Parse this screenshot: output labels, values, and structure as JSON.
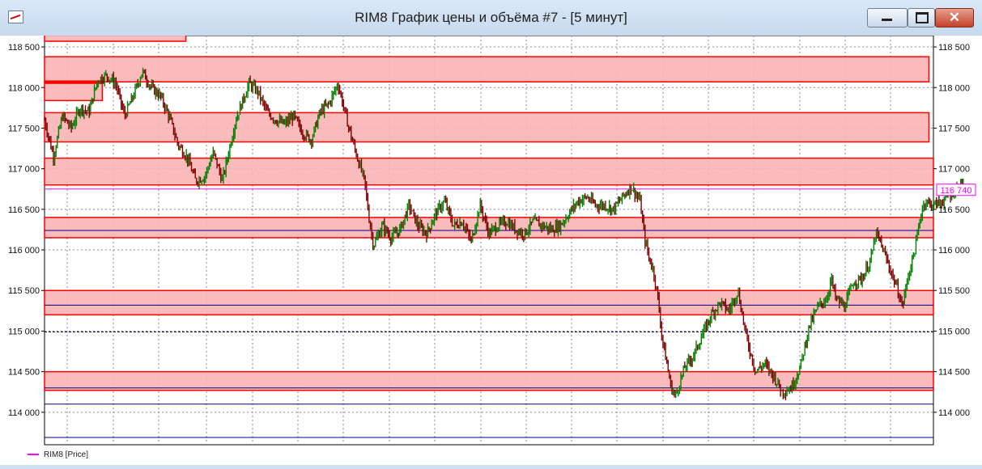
{
  "window": {
    "title": "RIM8 График цены и объёма #7 - [5 минут]",
    "minimize_icon": "minimize-icon",
    "maximize_icon": "maximize-icon",
    "close_icon": "close-icon"
  },
  "legend": {
    "label": "RIM8 [Price]",
    "color": "#ff00ff"
  },
  "chart_data": {
    "type": "candlestick",
    "y_tick_labels": [
      "118 500",
      "118 000",
      "117 500",
      "117 000",
      "116 500",
      "116 000",
      "115 500",
      "115 000",
      "114 500",
      "114 000"
    ],
    "y_ticks": [
      118500,
      118000,
      117500,
      117000,
      116500,
      116000,
      115500,
      115000,
      114500,
      114000
    ],
    "ylim": [
      113600,
      118640
    ],
    "last_price_label": "116 740",
    "last_price": 116740,
    "grid": true,
    "up_color": "#008000",
    "down_color": "#800000",
    "zone_fill": "#f8b4b4",
    "zone_border": "#ff0000",
    "level_color": "#000080",
    "zones": [
      {
        "x0": 0.0,
        "x1": 0.159,
        "y0": 118570,
        "y1": 118670
      },
      {
        "x0": 0.0,
        "x1": 0.995,
        "y0": 118070,
        "y1": 118380
      },
      {
        "x0": 0.0,
        "x1": 0.065,
        "y0": 117840,
        "y1": 118080
      },
      {
        "x0": 0.0,
        "x1": 0.995,
        "y0": 117330,
        "y1": 117690
      },
      {
        "x0": 0.0,
        "x1": 1.0,
        "y0": 116800,
        "y1": 117130
      },
      {
        "x0": 0.0,
        "x1": 1.0,
        "y0": 116150,
        "y1": 116400
      },
      {
        "x0": 0.0,
        "x1": 1.0,
        "y0": 115200,
        "y1": 115500
      },
      {
        "x0": 0.0,
        "x1": 1.0,
        "y0": 114270,
        "y1": 114500
      }
    ],
    "levels": [
      {
        "y": 118060,
        "color": "#ff0000",
        "width": 3,
        "x1": 0.065
      },
      {
        "y": 116750,
        "color": "#ff00ff",
        "width": 1,
        "x1": 1.0
      },
      {
        "y": 116240,
        "color": "#000080",
        "width": 1,
        "x1": 1.0
      },
      {
        "y": 115320,
        "color": "#000080",
        "width": 1,
        "x1": 1.0
      },
      {
        "y": 114990,
        "color": "#000080",
        "width": 1,
        "dash": true,
        "x1": 1.0
      },
      {
        "y": 114300,
        "color": "#000080",
        "width": 1,
        "x1": 1.0
      },
      {
        "y": 114100,
        "color": "#000080",
        "width": 1,
        "x1": 1.0
      },
      {
        "y": 113690,
        "color": "#000080",
        "width": 1,
        "x1": 1.0
      }
    ],
    "price_path": [
      [
        0,
        117600
      ],
      [
        0.01,
        117150
      ],
      [
        0.02,
        117650
      ],
      [
        0.03,
        117500
      ],
      [
        0.04,
        117750
      ],
      [
        0.05,
        117700
      ],
      [
        0.06,
        118100
      ],
      [
        0.07,
        118150
      ],
      [
        0.08,
        118050
      ],
      [
        0.09,
        117650
      ],
      [
        0.1,
        117900
      ],
      [
        0.11,
        118200
      ],
      [
        0.12,
        118000
      ],
      [
        0.13,
        117900
      ],
      [
        0.14,
        117650
      ],
      [
        0.15,
        117300
      ],
      [
        0.16,
        117150
      ],
      [
        0.17,
        116850
      ],
      [
        0.18,
        116900
      ],
      [
        0.19,
        117200
      ],
      [
        0.2,
        116850
      ],
      [
        0.21,
        117350
      ],
      [
        0.215,
        117600
      ],
      [
        0.22,
        117750
      ],
      [
        0.23,
        118050
      ],
      [
        0.24,
        117950
      ],
      [
        0.25,
        117700
      ],
      [
        0.26,
        117600
      ],
      [
        0.27,
        117550
      ],
      [
        0.28,
        117650
      ],
      [
        0.29,
        117450
      ],
      [
        0.3,
        117350
      ],
      [
        0.31,
        117700
      ],
      [
        0.32,
        117800
      ],
      [
        0.33,
        118050
      ],
      [
        0.34,
        117600
      ],
      [
        0.35,
        117200
      ],
      [
        0.36,
        116850
      ],
      [
        0.365,
        116400
      ],
      [
        0.37,
        116050
      ],
      [
        0.38,
        116300
      ],
      [
        0.39,
        116150
      ],
      [
        0.4,
        116250
      ],
      [
        0.41,
        116550
      ],
      [
        0.42,
        116300
      ],
      [
        0.43,
        116200
      ],
      [
        0.44,
        116450
      ],
      [
        0.45,
        116600
      ],
      [
        0.46,
        116300
      ],
      [
        0.47,
        116350
      ],
      [
        0.48,
        116100
      ],
      [
        0.49,
        116550
      ],
      [
        0.5,
        116200
      ],
      [
        0.51,
        116300
      ],
      [
        0.52,
        116350
      ],
      [
        0.53,
        116250
      ],
      [
        0.54,
        116200
      ],
      [
        0.55,
        116350
      ],
      [
        0.56,
        116300
      ],
      [
        0.57,
        116250
      ],
      [
        0.58,
        116300
      ],
      [
        0.59,
        116450
      ],
      [
        0.6,
        116600
      ],
      [
        0.61,
        116650
      ],
      [
        0.62,
        116550
      ],
      [
        0.63,
        116550
      ],
      [
        0.64,
        116500
      ],
      [
        0.65,
        116650
      ],
      [
        0.66,
        116780
      ],
      [
        0.67,
        116600
      ],
      [
        0.675,
        116150
      ],
      [
        0.68,
        115900
      ],
      [
        0.685,
        115750
      ],
      [
        0.69,
        115400
      ],
      [
        0.695,
        114900
      ],
      [
        0.7,
        114600
      ],
      [
        0.705,
        114300
      ],
      [
        0.71,
        114200
      ],
      [
        0.72,
        114550
      ],
      [
        0.73,
        114700
      ],
      [
        0.74,
        114950
      ],
      [
        0.75,
        115200
      ],
      [
        0.76,
        115350
      ],
      [
        0.77,
        115250
      ],
      [
        0.78,
        115500
      ],
      [
        0.785,
        115200
      ],
      [
        0.79,
        114900
      ],
      [
        0.8,
        114500
      ],
      [
        0.81,
        114600
      ],
      [
        0.82,
        114450
      ],
      [
        0.83,
        114250
      ],
      [
        0.84,
        114300
      ],
      [
        0.85,
        114550
      ],
      [
        0.86,
        115050
      ],
      [
        0.87,
        115300
      ],
      [
        0.88,
        115400
      ],
      [
        0.885,
        115650
      ],
      [
        0.89,
        115400
      ],
      [
        0.9,
        115300
      ],
      [
        0.91,
        115600
      ],
      [
        0.92,
        115650
      ],
      [
        0.93,
        115900
      ],
      [
        0.935,
        116200
      ],
      [
        0.94,
        116100
      ],
      [
        0.95,
        115800
      ],
      [
        0.96,
        115500
      ],
      [
        0.965,
        115300
      ],
      [
        0.97,
        115600
      ],
      [
        0.98,
        116050
      ],
      [
        0.985,
        116400
      ],
      [
        0.99,
        116600
      ],
      [
        1.0,
        116550
      ],
      [
        1.01,
        116600
      ],
      [
        1.02,
        116700
      ],
      [
        1.03,
        116800
      ],
      [
        1.04,
        116900
      ],
      [
        1.045,
        116800
      ]
    ]
  }
}
